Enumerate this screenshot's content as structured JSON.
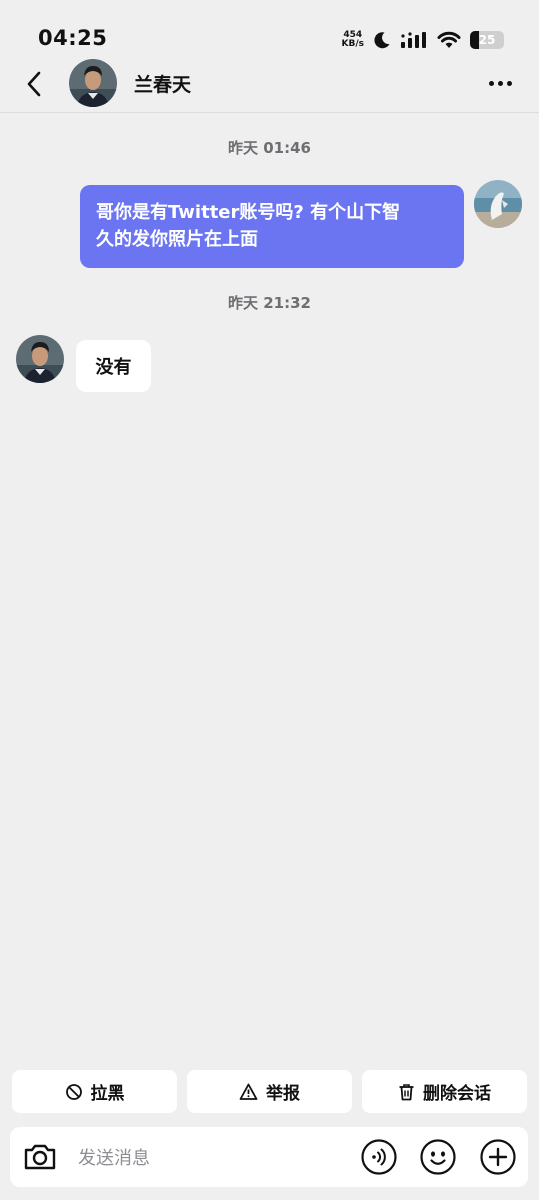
{
  "status_bar": {
    "time": "04:25",
    "net_speed_value": "454",
    "net_speed_unit": "KB/s",
    "battery_level": "25"
  },
  "header": {
    "contact_name": "兰春天",
    "back_icon": "chevron-left-icon",
    "more_icon": "ellipsis-icon"
  },
  "messages": [
    {
      "timestamp": "昨天 01:46",
      "direction": "outgoing",
      "text_line1": "哥你是有Twitter账号吗? 有个山下智",
      "text_line2": "久的发你照片在上面"
    },
    {
      "timestamp": "昨天 21:32",
      "direction": "incoming",
      "text": "没有"
    }
  ],
  "actions": {
    "block_label": "拉黑",
    "report_label": "举报",
    "delete_label": "删除会话"
  },
  "input": {
    "placeholder": "发送消息"
  },
  "colors": {
    "outgoing_bubble": "#6b75f2",
    "background": "#efefef"
  }
}
